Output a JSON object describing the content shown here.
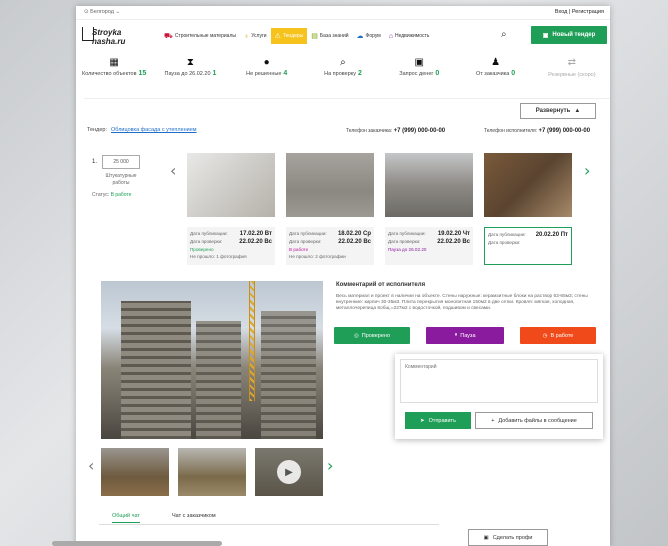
{
  "header": {
    "city": "Белгород",
    "city_arrow": "⌄",
    "auth": "Вход | Регистрация",
    "logo_line1": "Stroyka",
    "logo_line2": "nasha.ru"
  },
  "nav": [
    {
      "label": "Строительные материалы",
      "icon": "⛟",
      "color": "#c8143c"
    },
    {
      "label": "Услуги",
      "icon": "♁",
      "color": "#e8a010"
    },
    {
      "label": "Тендеры",
      "icon": "⚠",
      "color": "#ffffff"
    },
    {
      "label": "База знаний",
      "icon": "▤",
      "color": "#7aa000"
    },
    {
      "label": "Форум",
      "icon": "☁",
      "color": "#1e6ec8"
    },
    {
      "label": "Недвижимость",
      "icon": "⌂",
      "color": "#8a1aae"
    }
  ],
  "search_icon": "⌕",
  "new_tender": {
    "label": "Новый тендер",
    "icon": "▣"
  },
  "stats": [
    {
      "icon": "▦",
      "label": "Количество объектов",
      "value": "15"
    },
    {
      "icon": "⧗",
      "label": "Пауза до 26.02.20",
      "value": "1"
    },
    {
      "icon": "●",
      "label": "Не решенные",
      "value": "4"
    },
    {
      "icon": "⌕",
      "label": "На проверку",
      "value": "2"
    },
    {
      "icon": "▣",
      "label": "Запрос денег",
      "value": "0"
    },
    {
      "icon": "♟",
      "label": "От заказчика",
      "value": "0"
    },
    {
      "icon": "⇄",
      "label": "Резервные (скоро)",
      "value": ""
    }
  ],
  "expand": {
    "label": "Развернуть",
    "icon": "▲"
  },
  "tender": {
    "label": "Тендер:",
    "link": "Облицовка фасада с утеплением"
  },
  "phone_customer": {
    "label": "Телефон заказчика:",
    "value": "+7 (999) 000-00-00"
  },
  "phone_executor": {
    "label": "Телефон исполнителя:",
    "value": "+7 (999) 000-00-00"
  },
  "item": {
    "num": "1.",
    "qty": "25 000",
    "qty_label": "Штукатурные работы",
    "status_label": "Статус:",
    "status_value": "В работе"
  },
  "arrows": {
    "left": "‹",
    "right": "›"
  },
  "photos": [
    {
      "pub_label": "Дата публикации:",
      "pub": "17.02.20 Вт",
      "chk_label": "Дата проверки:",
      "chk": "22.02.20 Вс",
      "state": "Проверено",
      "state_class": "green",
      "note": "Не прошло: 1 фотография"
    },
    {
      "pub_label": "Дата публикации:",
      "pub": "18.02.20 Ср",
      "chk_label": "Дата проверки:",
      "chk": "22.02.20 Вс",
      "state": "В работе",
      "state_class": "pink",
      "note": "Не прошло: 2 фотографии"
    },
    {
      "pub_label": "Дата публикации:",
      "pub": "19.02.20 Чт",
      "chk_label": "Дата проверки:",
      "chk": "22.02.20 Вс",
      "state": "Пауза до 26.02.20",
      "state_class": "purple",
      "note": ""
    },
    {
      "pub_label": "Дата публикации:",
      "pub": "20.02.20 Пт",
      "chk_label": "Дата проверки:",
      "chk": "",
      "state": "",
      "state_class": "",
      "note": ""
    }
  ],
  "comment": {
    "title": "Комментарий от исполнителя",
    "text": "Весь материал и проект в наличии на объекте. Стены наружные: керамзитные блоки на раствор 63-65м3; стены внутренние: кирпич 30-35м3. Плита перекрытия монолитная 150м2 в две сетки. Кровля: мягкая, холодная, металлочерепица 5общ.=227м2 с водосточкой, подшивом и свесами."
  },
  "state_buttons": [
    {
      "label": "Проверено",
      "icon": "◎",
      "color": "#1e9e57"
    },
    {
      "label": "Пауза",
      "icon": "⏸",
      "color": "#8a1a9e"
    },
    {
      "label": "В работе",
      "icon": "◷",
      "color": "#f04a1a"
    }
  ],
  "composer": {
    "placeholder": "Комментарий",
    "send": "Отправить",
    "send_icon": "➤",
    "attach": "Добавить файлы в сообщение",
    "attach_icon": "+"
  },
  "play_icon": "▶",
  "tabs": [
    "Общий чат",
    "Чат с заказчиком"
  ],
  "profi": {
    "label": "Сделать профи",
    "icon": "▣"
  }
}
